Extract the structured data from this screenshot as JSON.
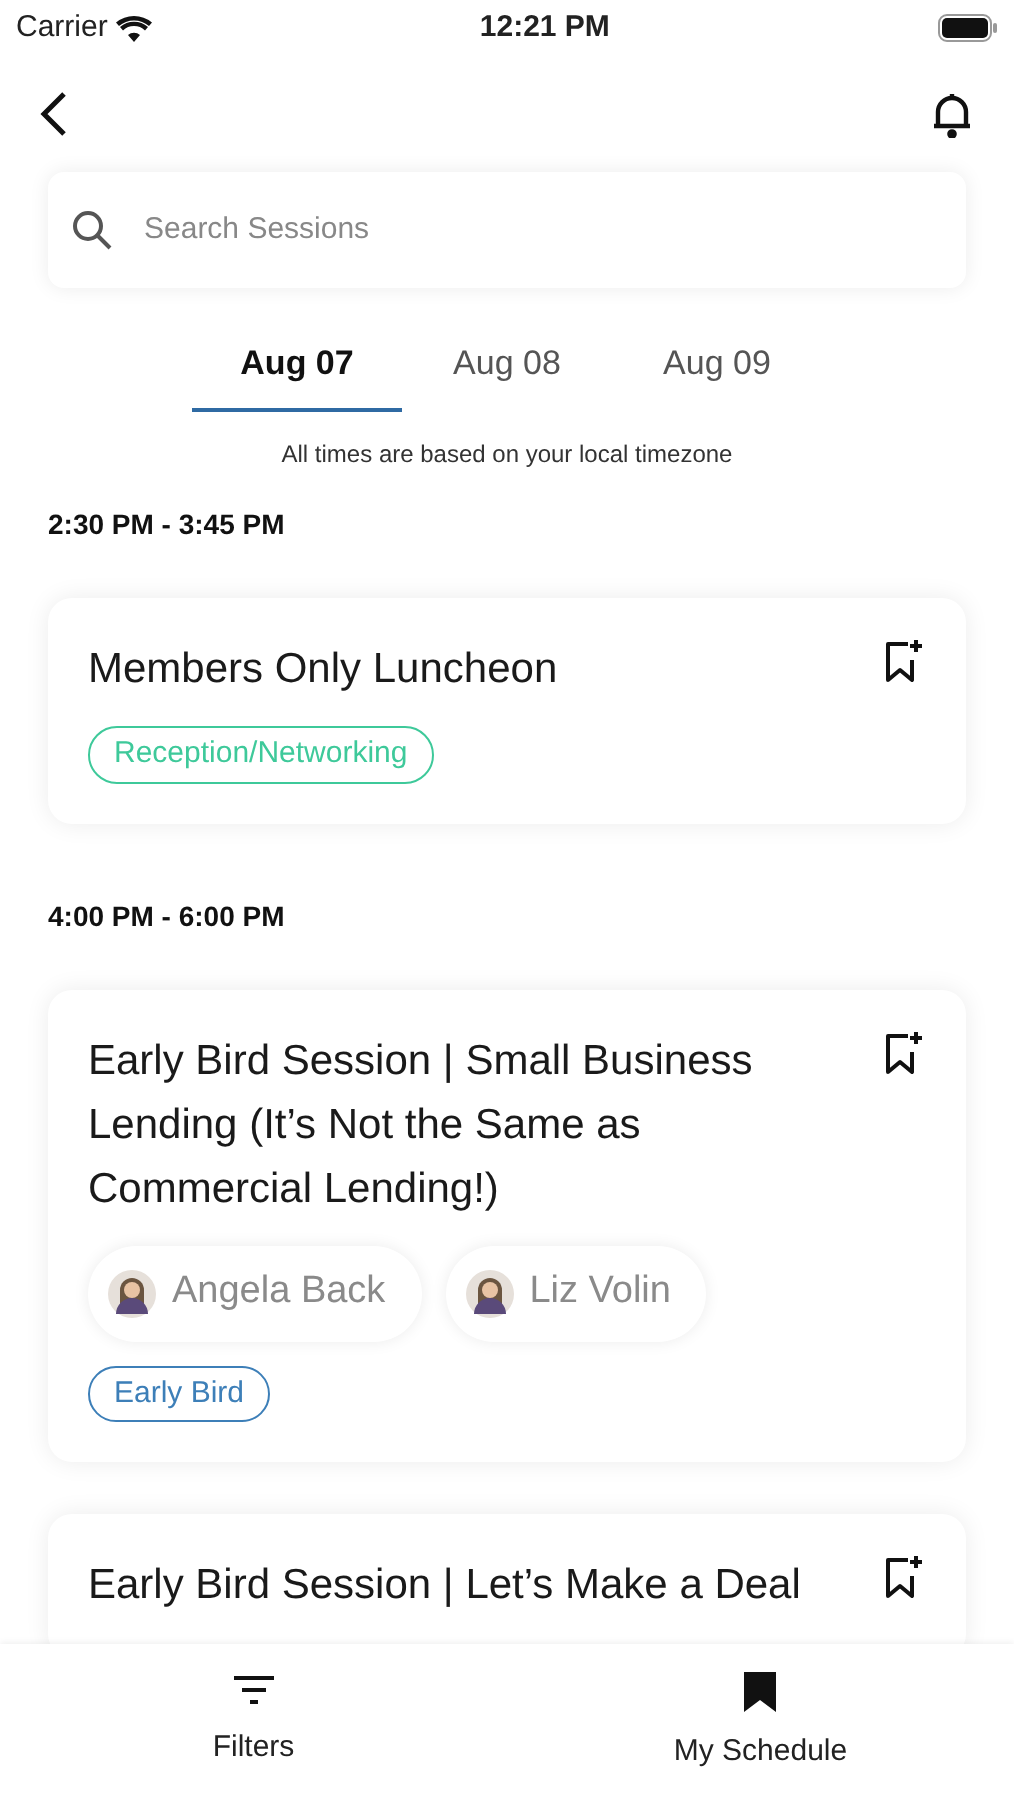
{
  "status_bar": {
    "carrier": "Carrier",
    "time": "12:21 PM"
  },
  "search": {
    "placeholder": "Search Sessions"
  },
  "tabs": [
    {
      "label": "Aug 07",
      "selected": true
    },
    {
      "label": "Aug 08",
      "selected": false
    },
    {
      "label": "Aug 09",
      "selected": false
    }
  ],
  "timezone_note": "All times are based on your local timezone",
  "groups": [
    {
      "time": "2:30 PM - 3:45 PM",
      "sessions": [
        {
          "title": "Members Only Luncheon",
          "tags": [
            {
              "label": "Reception/Networking",
              "color": "#3ec99a"
            }
          ]
        }
      ]
    },
    {
      "time": "4:00 PM - 6:00 PM",
      "sessions": [
        {
          "title": "Early Bird Session | Small Business Lending (It’s Not the Same as Commercial Lending!)",
          "speakers": [
            {
              "name": "Angela Back"
            },
            {
              "name": "Liz Volin"
            }
          ],
          "tags": [
            {
              "label": "Early Bird",
              "color": "#3d7fb8"
            }
          ]
        },
        {
          "title": "Early Bird Session | Let’s Make a Deal"
        }
      ]
    }
  ],
  "bottom_nav": [
    {
      "label": "Filters",
      "kind": "filter"
    },
    {
      "label": "My Schedule",
      "kind": "bookmark"
    }
  ]
}
